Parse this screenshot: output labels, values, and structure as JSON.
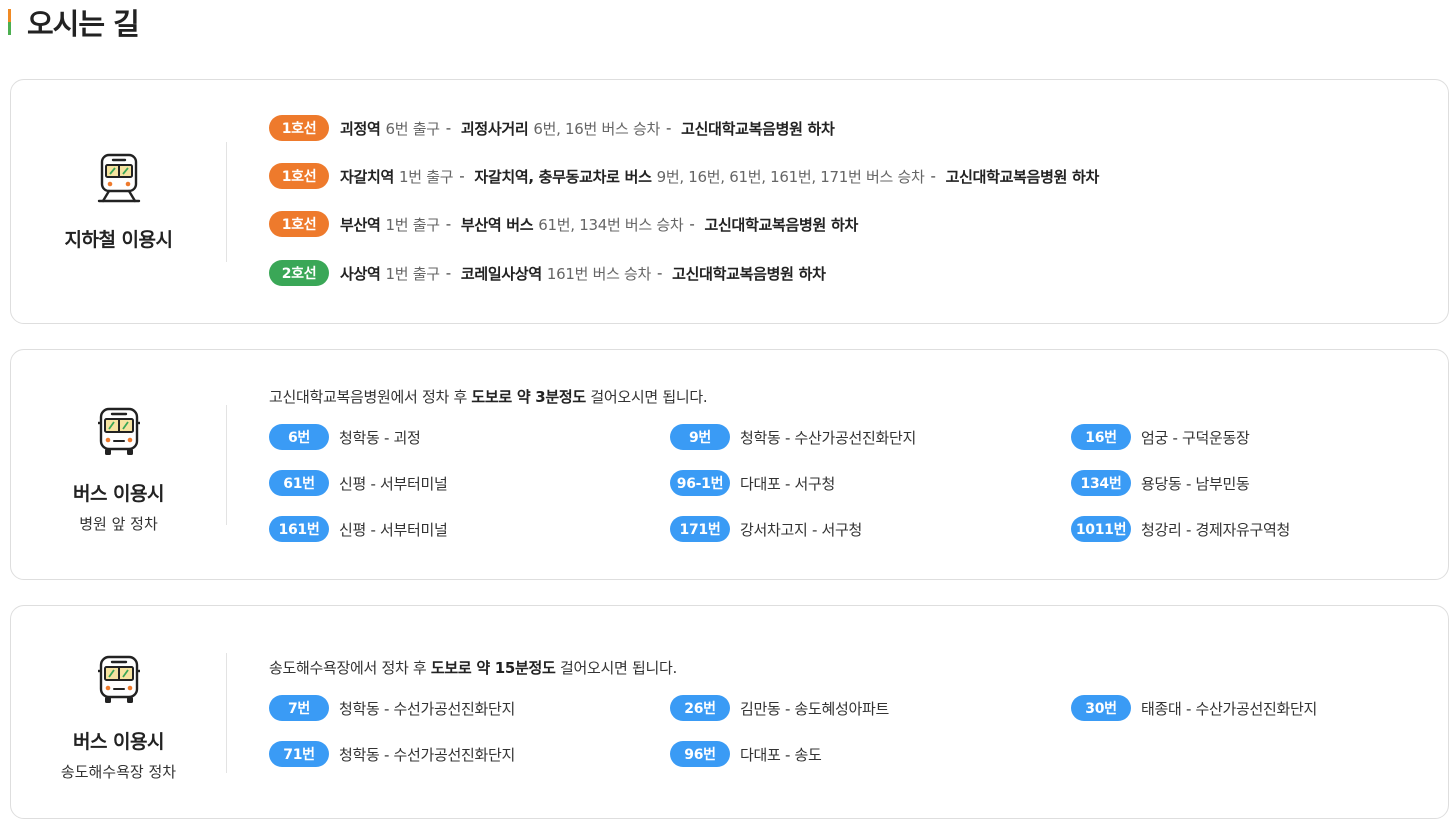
{
  "page": {
    "title": "오시는 길"
  },
  "subway": {
    "side_title": "지하철 이용시",
    "routes": [
      {
        "line": "1호선",
        "line_color": "#ee7a2c",
        "station": "괴정역",
        "exit": "6번 출구",
        "transfer": "괴정사거리",
        "bus": "6번, 16번 버스 승차",
        "dest": "고신대학교복음병원 하차"
      },
      {
        "line": "1호선",
        "line_color": "#ee7a2c",
        "station": "자갈치역",
        "exit": "1번 출구",
        "transfer": "자갈치역, 충무동교차로 버스",
        "bus": "9번, 16번, 61번, 161번, 171번 버스 승차",
        "dest": "고신대학교복음병원 하차"
      },
      {
        "line": "1호선",
        "line_color": "#ee7a2c",
        "station": "부산역",
        "exit": "1번 출구",
        "transfer": "부산역 버스",
        "bus": "61번, 134번 버스 승차",
        "dest": "고신대학교복음병원 하차"
      },
      {
        "line": "2호선",
        "line_color": "#3aa757",
        "station": "사상역",
        "exit": "1번 출구",
        "transfer": "코레일사상역",
        "bus": "161번 버스 승차",
        "dest": "고신대학교복음병원 하차"
      }
    ],
    "separator": "-"
  },
  "bus_hospital": {
    "side_title": "버스 이용시",
    "side_sub": "병원 앞 정차",
    "intro_pre": "고신대학교복음병원에서 정차 후 ",
    "intro_bold": "도보로 약 3분정도",
    "intro_post": " 걸어오시면 됩니다.",
    "buses": [
      {
        "num": "6번",
        "desc": "청학동 - 괴정"
      },
      {
        "num": "9번",
        "desc": "청학동 - 수산가공선진화단지"
      },
      {
        "num": "16번",
        "desc": "엄궁 - 구덕운동장"
      },
      {
        "num": "61번",
        "desc": "신평 - 서부터미널"
      },
      {
        "num": "96-1번",
        "desc": "다대포 - 서구청"
      },
      {
        "num": "134번",
        "desc": "용당동 - 남부민동"
      },
      {
        "num": "161번",
        "desc": "신평 - 서부터미널"
      },
      {
        "num": "171번",
        "desc": "강서차고지 - 서구청"
      },
      {
        "num": "1011번",
        "desc": "청강리 - 경제자유구역청"
      }
    ]
  },
  "bus_beach": {
    "side_title": "버스 이용시",
    "side_sub": "송도해수욕장 정차",
    "intro_pre": "송도해수욕장에서 정차 후 ",
    "intro_bold": "도보로 약 15분정도",
    "intro_post": " 걸어오시면 됩니다.",
    "buses": [
      {
        "num": "7번",
        "desc": "청학동 - 수선가공선진화단지"
      },
      {
        "num": "26번",
        "desc": "김만동 - 송도혜성아파트"
      },
      {
        "num": "30번",
        "desc": "태종대 - 수산가공선진화단지"
      },
      {
        "num": "71번",
        "desc": "청학동 - 수선가공선진화단지"
      },
      {
        "num": "96번",
        "desc": "다대포 - 송도"
      }
    ]
  },
  "colors": {
    "orange": "#ee7a2c",
    "green": "#3aa757",
    "blue": "#3a9bf5",
    "accent_bar_top": "#f08a24",
    "accent_bar_bottom": "#4caf50"
  },
  "icons": {
    "subway": "subway-train-icon",
    "bus": "bus-icon"
  }
}
